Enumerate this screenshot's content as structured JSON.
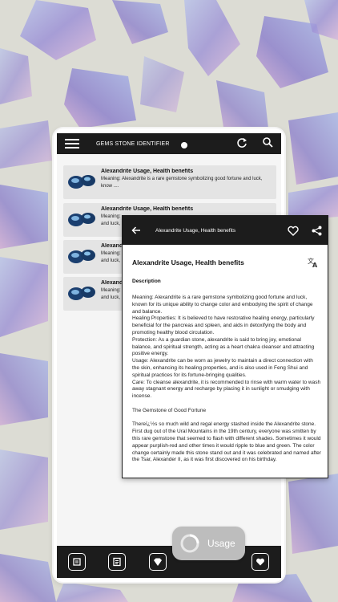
{
  "app": {
    "title": "GEMS STONE IDENTIFIER"
  },
  "list": {
    "items": [
      {
        "title": "Alexandrite Usage, Health benefits",
        "desc": " Meaning: Alexandrite is a rare gemstone symbolizing good fortune and luck, know ...."
      },
      {
        "title": "Alexandrite Usage, Health benefits",
        "desc": " Meaning:\nand luck,"
      },
      {
        "title": "Alexandrit",
        "desc": " Meaning:\nand luck,"
      },
      {
        "title": "Alexandrit",
        "desc": " Meaning:\nand luck,"
      }
    ]
  },
  "detail": {
    "bar_title": "Alexandrite Usage, Health benefits",
    "heading": "Alexandrite Usage, Health benefits",
    "section_label": "Description",
    "paragraph_1": " Meaning: Alexandrite is a rare gemstone symbolizing good fortune and luck, known for its unique ability to change color and embodying the spirit of change and balance.\nHealing Properties: It is believed to have restorative healing energy, particularly beneficial for the pancreas and spleen, and aids in detoxifying the body and promoting healthy blood circulation.\nProtection: As a guardian stone, alexandrite is said to bring joy, emotional balance, and spiritual strength, acting as a heart chakra cleanser and attracting positive energy.\nUsage: Alexandrite can be worn as jewelry to maintain a direct connection with the skin, enhancing its healing properties, and is also used in Feng Shui and spiritual practices for its fortune-bringing qualities.\nCare: To cleanse alexandrite, it is recommended to rinse with warm water to wash away stagnant energy and recharge by placing it in sunlight or smudging with incense.",
    "paragraph_2": "The Gemstone of Good Fortune",
    "paragraph_3": "Thereï¿½s so much wild and regal energy stashed inside the Alexandrite stone. First dug out of the Ural Mountains in the 19th century, everyone was smitten by this rare gemstone that seemed to flash with different shades. Sometimes it would appear purplish-red and other times it would ripple to blue and green. The color change certainly made this stone stand out and it was celebrated and named after the Tsar, Alexander II, as it was first discovered on his birthday."
  },
  "fab": {
    "label": "Usage"
  },
  "icons": {
    "menu": "menu-icon",
    "refresh": "refresh-icon",
    "search": "search-icon",
    "back": "back-arrow-icon",
    "favorite": "heart-outline-icon",
    "share": "share-icon",
    "translate": "translate-icon",
    "nav": [
      "scan-icon",
      "list-icon",
      "gem-icon",
      "heart-icon"
    ]
  },
  "colors": {
    "bar": "#1c1c1c",
    "card": "#e4e4e4",
    "fab": "#bdbdbd"
  }
}
